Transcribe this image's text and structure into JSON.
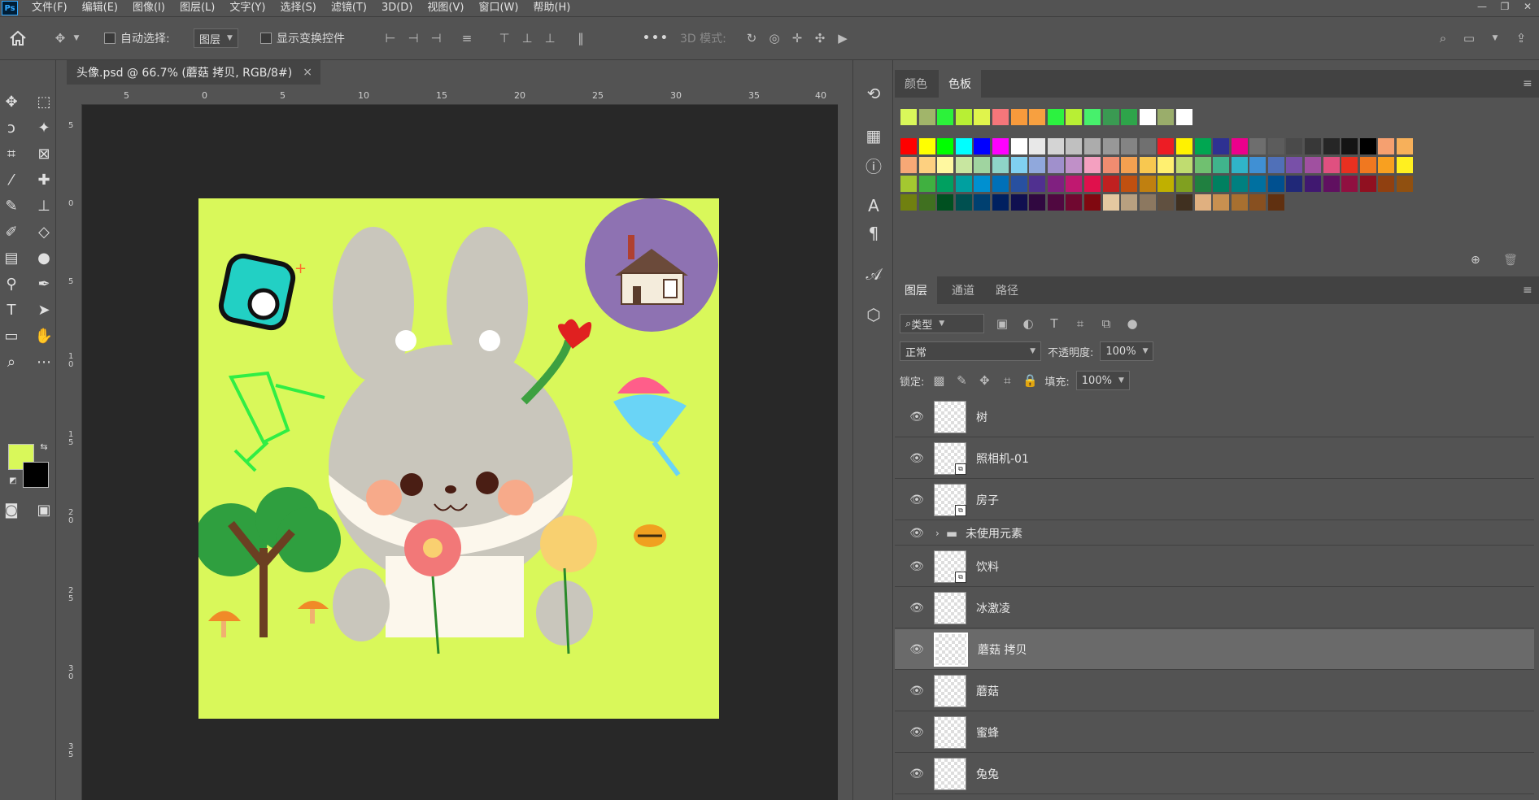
{
  "app": {
    "logo": "Ps"
  },
  "menu": [
    "文件(F)",
    "编辑(E)",
    "图像(I)",
    "图层(L)",
    "文字(Y)",
    "选择(S)",
    "滤镜(T)",
    "3D(D)",
    "视图(V)",
    "窗口(W)",
    "帮助(H)"
  ],
  "options": {
    "auto_select_label": "自动选择:",
    "auto_select_target": "图层",
    "show_transform_label": "显示变换控件",
    "three_d_mode_label": "3D 模式:",
    "more": "•••"
  },
  "document": {
    "tab_title": "头像.psd @ 66.7% (蘑菇 拷贝, RGB/8#)",
    "close": "×",
    "ruler_top_ticks": [
      "5",
      "0",
      "5",
      "10",
      "15",
      "20",
      "25",
      "30",
      "35",
      "40"
    ],
    "ruler_left_ticks": [
      "5",
      "0",
      "5",
      "1 0",
      "1 5",
      "2 0",
      "2 5",
      "3 0",
      "3 5"
    ]
  },
  "colors": {
    "foreground": "#d9f85a",
    "background": "#000000",
    "artboard_bg": "#d9f85a"
  },
  "swatches_panel": {
    "tabs": [
      "颜色",
      "色板"
    ],
    "active_tab": "色板",
    "recent": [
      "#d9f85a",
      "#a1b56a",
      "#2cf23a",
      "#b8ef34",
      "#e0f44c",
      "#f5767a",
      "#f79a3c",
      "#f7a040",
      "#2cf240",
      "#b8ef34",
      "#47f06c",
      "#3a9a52",
      "#2ea44a",
      "#ffffff",
      "#9aad6b",
      "#ffffff"
    ],
    "rows": [
      [
        "#ff0000",
        "#ffff00",
        "#00ff00",
        "#00ffff",
        "#0000ff",
        "#ff00ff",
        "#ffffff",
        "#e8e8e8",
        "#d4d4d4",
        "#c0c0c0",
        "#acacac",
        "#989898",
        "#848484",
        "#707070",
        "#ed1c24",
        "#fff200",
        "#00a651",
        "#2e3192",
        "#ec008c",
        "#6e6e6e",
        "#5c5c5c",
        "#4a4a4a",
        "#383838",
        "#262626",
        "#141414",
        "#000000",
        "#f5a070",
        "#f7b05a"
      ],
      [
        "#f7a876",
        "#fdd080",
        "#fff8a0",
        "#c8e6a0",
        "#a0d4a0",
        "#8ed4c8",
        "#80d0f0",
        "#90a8dc",
        "#a090cc",
        "#c090c8",
        "#f4a0c0",
        "#f08c70",
        "#f4a050",
        "#f8c850",
        "#fff070",
        "#c0dc70",
        "#70c070",
        "#40b48c",
        "#30b4c8",
        "#4090d4",
        "#5070b8",
        "#7850a8",
        "#a050a0",
        "#e05080",
        "#e83020",
        "#f07820",
        "#f8a020",
        "#fff020"
      ],
      [
        "#a4c830",
        "#40b040",
        "#00a060",
        "#00a0a0",
        "#0090d0",
        "#0070b8",
        "#2850a0",
        "#503090",
        "#802080",
        "#c01870",
        "#e0104c",
        "#c02020",
        "#c05010",
        "#c08010",
        "#c0b000",
        "#80a020",
        "#208040",
        "#008060",
        "#008080",
        "#0070a0",
        "#005090",
        "#202878",
        "#401870",
        "#601060",
        "#901040",
        "#901020",
        "#904010",
        "#905010"
      ],
      [
        "#708010",
        "#407020",
        "#005020",
        "#005050",
        "#004070",
        "#002060",
        "#101050",
        "#300840",
        "#500840",
        "#700830",
        "#800810",
        "#e4c8a0",
        "#b8a080",
        "#8c7860",
        "#605040",
        "#403020",
        "#e0b080",
        "#c89050",
        "#a87030",
        "#885020",
        "#603010"
      ]
    ]
  },
  "layers_panel": {
    "tabs": [
      "图层",
      "通道",
      "路径"
    ],
    "active_tab": "图层",
    "filter_kind": "类型",
    "blend_mode": "正常",
    "opacity_label": "不透明度:",
    "opacity_value": "100%",
    "lock_label": "锁定:",
    "fill_label": "填充:",
    "fill_value": "100%",
    "layers": [
      {
        "name": "树",
        "smart": false
      },
      {
        "name": "照相机-01",
        "smart": true
      },
      {
        "name": "房子",
        "smart": true
      },
      {
        "name": "未使用元素",
        "group": true
      },
      {
        "name": "饮料",
        "smart": true
      },
      {
        "name": "冰激凌",
        "smart": false
      },
      {
        "name": "蘑菇 拷贝",
        "smart": false,
        "selected": true
      },
      {
        "name": "蘑菇",
        "smart": false
      },
      {
        "name": "蜜蜂",
        "smart": false
      },
      {
        "name": "兔兔",
        "smart": false
      }
    ]
  }
}
